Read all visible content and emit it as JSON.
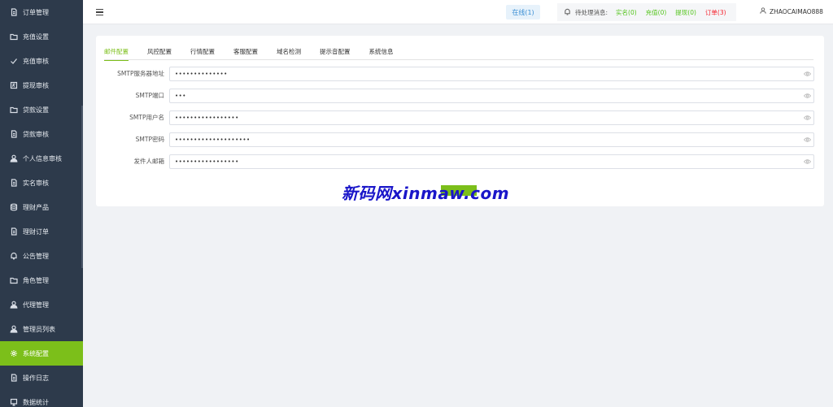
{
  "sidebar": {
    "items": [
      {
        "label": "订单管理",
        "icon": "document-icon",
        "active": false
      },
      {
        "label": "充值设置",
        "icon": "folder-icon",
        "active": false
      },
      {
        "label": "充值审核",
        "icon": "check-icon",
        "active": false
      },
      {
        "label": "提现审核",
        "icon": "doc-image-icon",
        "active": false
      },
      {
        "label": "贷款设置",
        "icon": "folder-icon",
        "active": false
      },
      {
        "label": "贷款审核",
        "icon": "document-icon",
        "active": false
      },
      {
        "label": "个人信息审核",
        "icon": "user-icon",
        "active": false
      },
      {
        "label": "实名审核",
        "icon": "document-icon",
        "active": false
      },
      {
        "label": "理财产品",
        "icon": "database-icon",
        "active": false
      },
      {
        "label": "理财订单",
        "icon": "document-icon",
        "active": false
      },
      {
        "label": "公告管理",
        "icon": "bell-icon",
        "active": false
      },
      {
        "label": "角色管理",
        "icon": "folder-icon",
        "active": false
      },
      {
        "label": "代理管理",
        "icon": "user-icon",
        "active": false
      },
      {
        "label": "管理员列表",
        "icon": "user-icon",
        "active": false
      },
      {
        "label": "系统配置",
        "icon": "gear-icon",
        "active": true
      },
      {
        "label": "操作日志",
        "icon": "document-icon",
        "active": false
      },
      {
        "label": "数据统计",
        "icon": "chart-icon",
        "active": false
      }
    ]
  },
  "header": {
    "online": "在线(1)",
    "pending_label": "待处理消息:",
    "pending": [
      {
        "label": "实名(0)",
        "color": "#52c41a"
      },
      {
        "label": "充值(0)",
        "color": "#52c41a"
      },
      {
        "label": "提现(0)",
        "color": "#52c41a"
      },
      {
        "label": "订单(3)",
        "color": "#f5222d"
      }
    ],
    "username": "ZHAOCAIMAO888"
  },
  "tabs": [
    {
      "label": "邮件配置",
      "active": true
    },
    {
      "label": "风控配置",
      "active": false
    },
    {
      "label": "行情配置",
      "active": false
    },
    {
      "label": "客服配置",
      "active": false
    },
    {
      "label": "域名检测",
      "active": false
    },
    {
      "label": "提示音配置",
      "active": false
    },
    {
      "label": "系统信息",
      "active": false
    }
  ],
  "form": [
    {
      "label": "SMTP服务器地址",
      "value": "••••••••••••••"
    },
    {
      "label": "SMTP端口",
      "value": "•••"
    },
    {
      "label": "SMTP用户名",
      "value": "•••••••••••••••••"
    },
    {
      "label": "SMTP密码",
      "value": "••••••••••••••••••••"
    },
    {
      "label": "发件人邮箱",
      "value": "•••••••••••••••••"
    }
  ],
  "watermark": "新码网xinmaw.com",
  "colors": {
    "sidebar_bg": "#2d3a4b",
    "accent": "#7cbf1a",
    "online_text": "#3b8fd4",
    "watermark": "#1a16c9"
  }
}
